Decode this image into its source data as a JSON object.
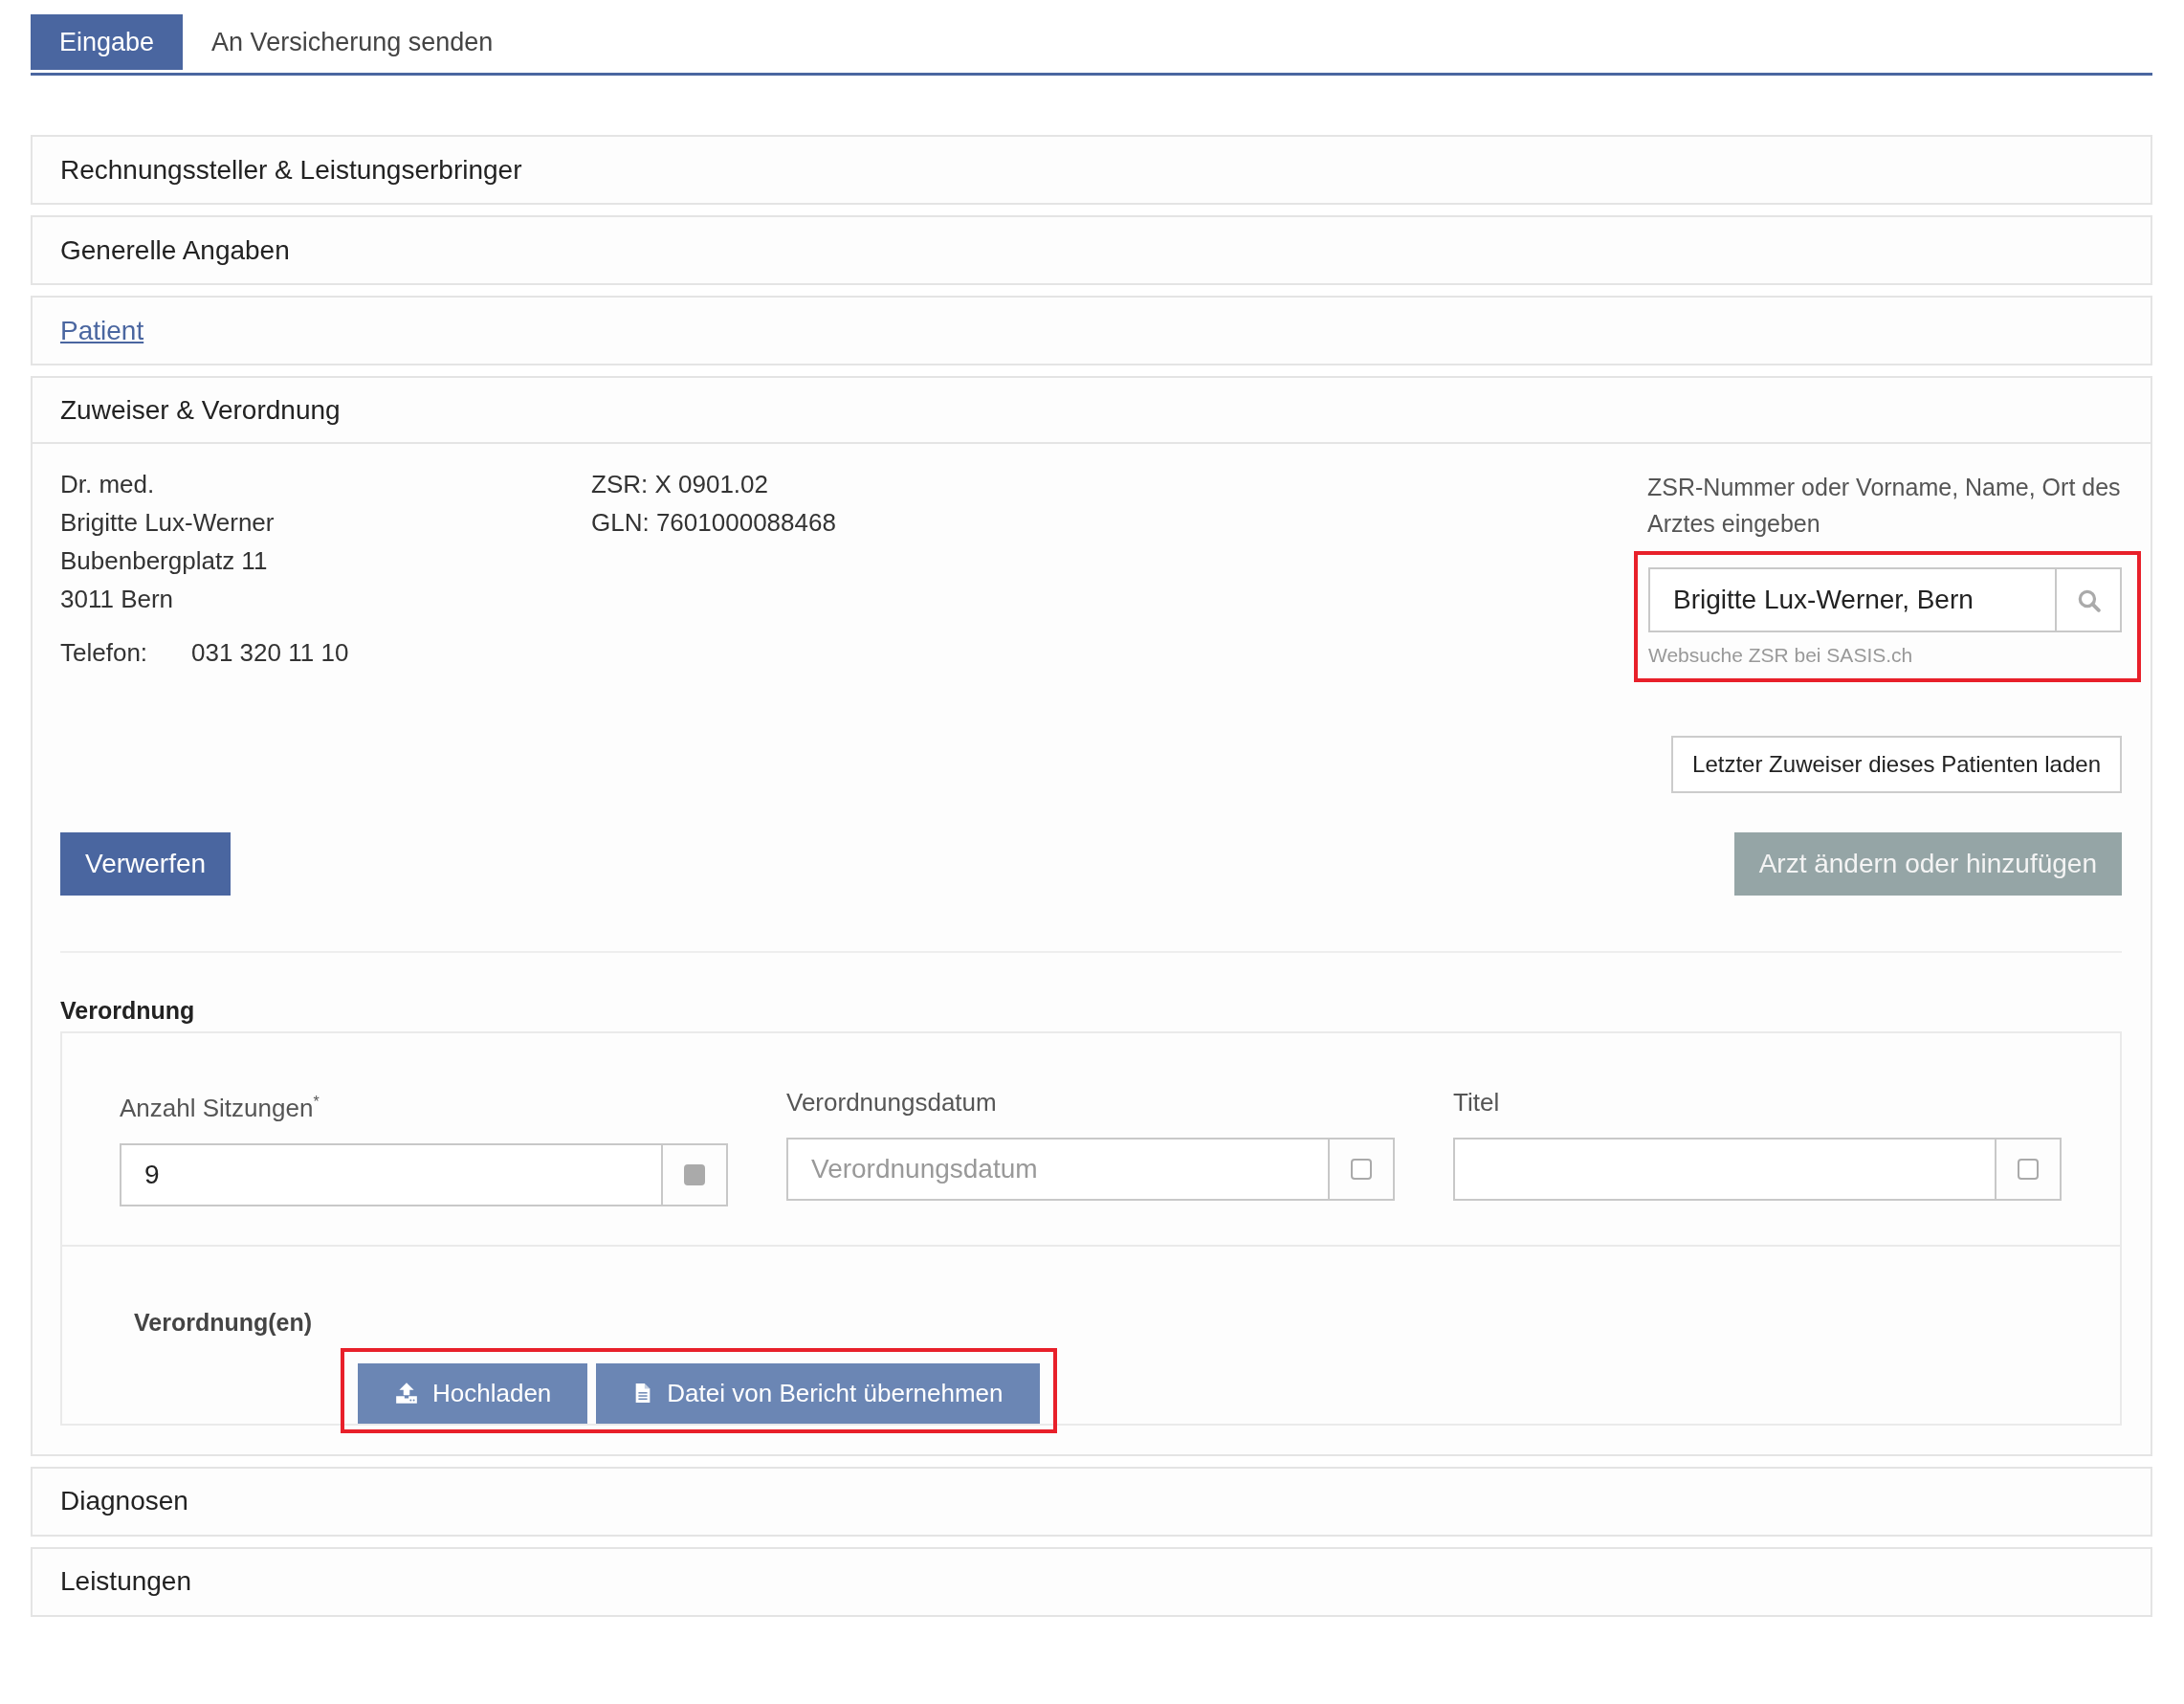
{
  "tabs": [
    {
      "label": "Eingabe",
      "selected": true
    },
    {
      "label": "An Versicherung senden",
      "selected": false
    }
  ],
  "sections": [
    {
      "title": "Rechnungssteller & Leistungserbringer",
      "kind": "header",
      "expanded": false
    },
    {
      "title": "Generelle Angaben",
      "kind": "header",
      "expanded": false
    },
    {
      "title": "Patient",
      "kind": "link",
      "expanded": false
    },
    {
      "title": "Zuweiser & Verordnung",
      "kind": "header",
      "expanded": true
    },
    {
      "title": "Diagnosen",
      "kind": "header",
      "expanded": false
    },
    {
      "title": "Leistungen",
      "kind": "header",
      "expanded": false
    }
  ],
  "referrer": {
    "address_lines": [
      "Dr. med.",
      "Brigitte Lux-Werner",
      "Bubenbergplatz 11",
      "3011 Bern"
    ],
    "phone_label": "Telefon:",
    "phone": "031 320 11 10",
    "ids": [
      "ZSR: X 0901.02",
      "GLN: 7601000088468"
    ],
    "search": {
      "label": "ZSR-Nummer oder Vorname, Name, Ort des Arztes eingeben",
      "value": "Brigitte Lux-Werner, Bern",
      "hint_link": "Websuche ZSR bei SASIS.ch",
      "highlighted": true
    },
    "load_last_button": "Letzter Zuweiser dieses Patienten laden",
    "discard_button": "Verwerfen",
    "change_button": "Arzt ändern oder hinzufügen"
  },
  "prescription": {
    "title": "Verordnung",
    "fields": [
      {
        "label": "Anzahl Sitzungen$^{*}$",
        "value": "9",
        "checked": true
      },
      {
        "label": "Verordnungsdatum",
        "placeholder": "Verordnungsdatum",
        "checked": false
      },
      {
        "label": "Titel",
        "checked": false
      }
    ],
    "files_label": "Verordnung(en)",
    "files_highlighted": true,
    "file_buttons": [
      {
        "label": "Hochladen",
        "kind": "upload"
      },
      {
        "label": "Datei von Bericht übernehmen",
        "kind": "document"
      }
    ]
  }
}
